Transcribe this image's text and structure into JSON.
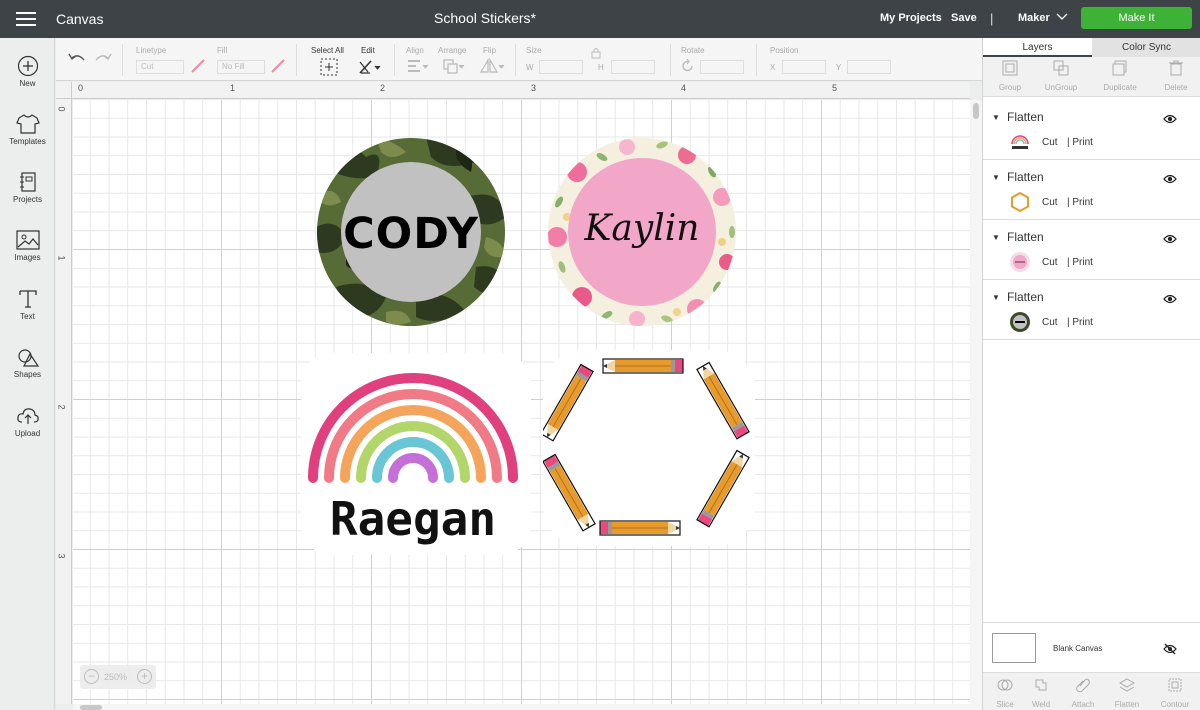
{
  "header": {
    "app_name": "Canvas",
    "document_title": "School Stickers*",
    "my_projects": "My Projects",
    "save": "Save",
    "separator": "|",
    "machine": "Maker",
    "make_it": "Make It"
  },
  "leftbar": {
    "items": [
      {
        "label": "New",
        "icon": "plus-circle-icon"
      },
      {
        "label": "Templates",
        "icon": "tshirt-icon"
      },
      {
        "label": "Projects",
        "icon": "notebook-icon"
      },
      {
        "label": "Images",
        "icon": "image-icon"
      },
      {
        "label": "Text",
        "icon": "text-t-icon"
      },
      {
        "label": "Shapes",
        "icon": "shapes-icon"
      },
      {
        "label": "Upload",
        "icon": "cloud-upload-icon"
      }
    ]
  },
  "edit_toolbar": {
    "linetype_label": "Linetype",
    "linetype_value": "Cut",
    "fill_label": "Fill",
    "fill_value": "No Fill",
    "select_all": "Select All",
    "edit": "Edit",
    "align": "Align",
    "arrange": "Arrange",
    "flip": "Flip",
    "size": "Size",
    "w": "W",
    "h": "H",
    "rotate": "Rotate",
    "position": "Position",
    "x": "X",
    "y": "Y"
  },
  "rulers": {
    "top": [
      "0",
      "1",
      "2",
      "3",
      "4",
      "5"
    ],
    "left": [
      "0",
      "1",
      "2",
      "3"
    ]
  },
  "zoom": {
    "value": "250%",
    "minus": "−",
    "plus": "+"
  },
  "stickers": {
    "cody": "CODY",
    "kaylin": "Kaylin",
    "raegan": "Raegan"
  },
  "panel": {
    "tabs": {
      "layers": "Layers",
      "color_sync": "Color Sync"
    },
    "tools": [
      "Group",
      "UnGroup",
      "Duplicate",
      "Delete"
    ],
    "layers": [
      {
        "name": "Flatten",
        "cut": "Cut",
        "print": "| Print",
        "thumb": "rainbow"
      },
      {
        "name": "Flatten",
        "cut": "Cut",
        "print": "| Print",
        "thumb": "pencils"
      },
      {
        "name": "Flatten",
        "cut": "Cut",
        "print": "| Print",
        "thumb": "kaylin"
      },
      {
        "name": "Flatten",
        "cut": "Cut",
        "print": "| Print",
        "thumb": "cody"
      }
    ],
    "blank_canvas": "Blank Canvas",
    "bottom_tools": [
      "Slice",
      "Weld",
      "Attach",
      "Flatten",
      "Contour"
    ]
  },
  "colors": {
    "topbar": "#3d4346",
    "make_it": "#3eb137",
    "camo_dark": "#2e3a20",
    "camo_mid": "#566b36",
    "kaylin_pink": "#f2a7c8",
    "pencil_orange": "#e69b2c",
    "pencil_eraser": "#e84a7f"
  }
}
